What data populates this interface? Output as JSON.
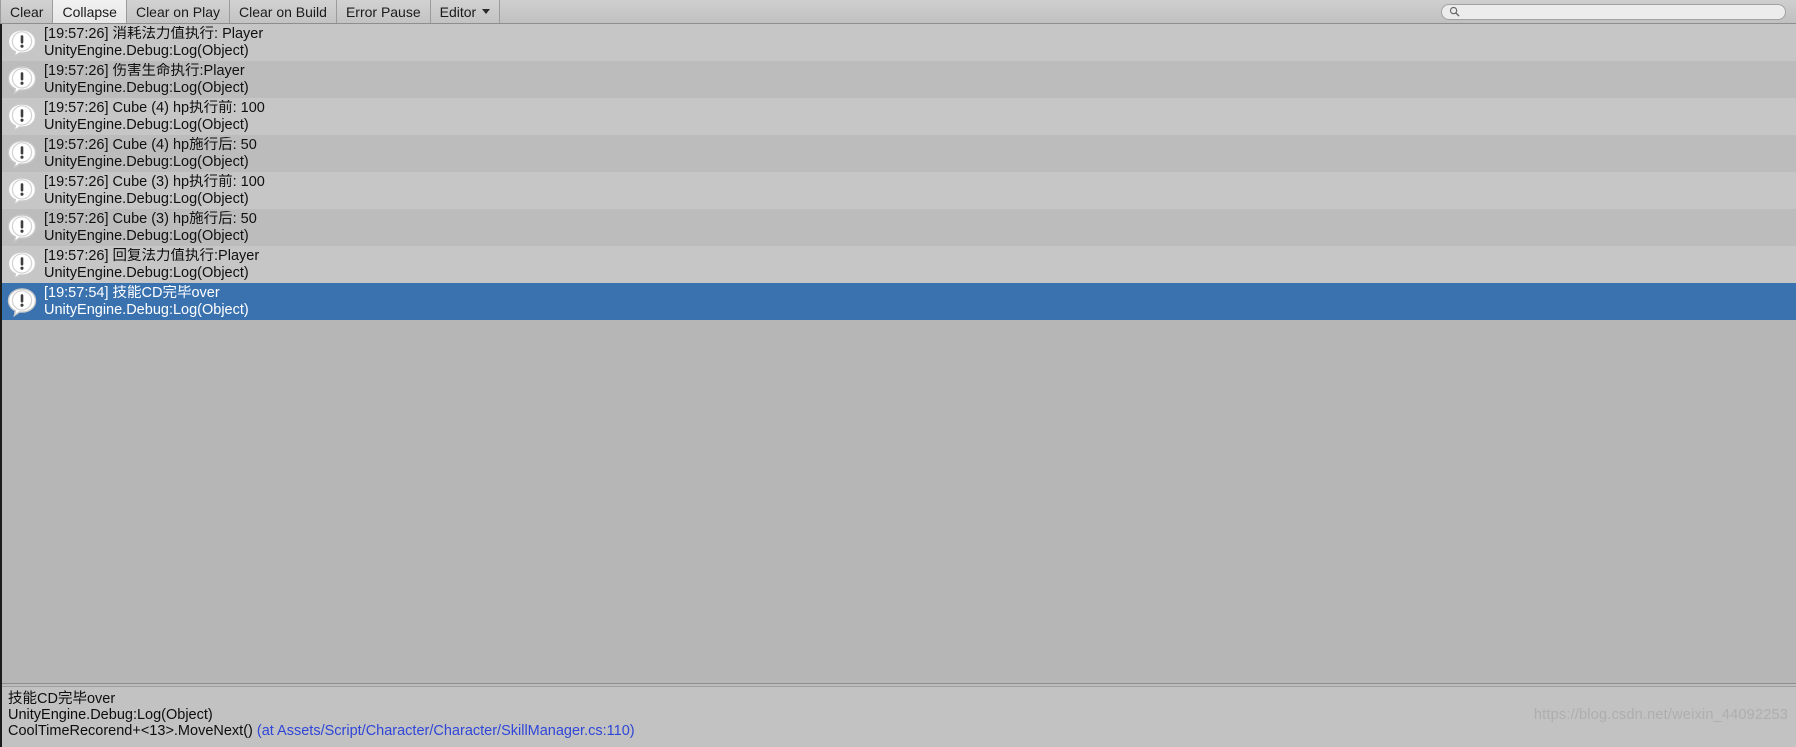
{
  "window": {
    "title": "Console",
    "accent_color": "#4a86c5",
    "selected_row_color": "#3a72b0",
    "row_color_even": "#c6c6c6",
    "row_color_odd": "#bcbcbc",
    "background_color": "#b6b6b6"
  },
  "toolbar": {
    "buttons": [
      {
        "label": "Clear",
        "toggled": false,
        "has_caret": false
      },
      {
        "label": "Collapse",
        "toggled": true,
        "has_caret": false
      },
      {
        "label": "Clear on Play",
        "toggled": false,
        "has_caret": false
      },
      {
        "label": "Clear on Build",
        "toggled": false,
        "has_caret": false
      },
      {
        "label": "Error Pause",
        "toggled": false,
        "has_caret": false
      },
      {
        "label": "Editor",
        "toggled": false,
        "has_caret": true
      }
    ],
    "search": {
      "value": "",
      "placeholder": "",
      "icon": "search-icon"
    }
  },
  "log_list": {
    "icon_name": "log-message-icon",
    "entries": [
      {
        "message": "[19:57:26] 消耗法力值执行:  Player",
        "stack": "UnityEngine.Debug:Log(Object)",
        "selected": false
      },
      {
        "message": "[19:57:26] 伤害生命执行:Player",
        "stack": "UnityEngine.Debug:Log(Object)",
        "selected": false
      },
      {
        "message": "[19:57:26] Cube (4) hp执行前: 100",
        "stack": "UnityEngine.Debug:Log(Object)",
        "selected": false
      },
      {
        "message": "[19:57:26] Cube (4) hp施行后: 50",
        "stack": "UnityEngine.Debug:Log(Object)",
        "selected": false
      },
      {
        "message": "[19:57:26] Cube (3) hp执行前: 100",
        "stack": "UnityEngine.Debug:Log(Object)",
        "selected": false
      },
      {
        "message": "[19:57:26] Cube (3) hp施行后: 50",
        "stack": "UnityEngine.Debug:Log(Object)",
        "selected": false
      },
      {
        "message": "[19:57:26] 回复法力值执行:Player",
        "stack": "UnityEngine.Debug:Log(Object)",
        "selected": false
      },
      {
        "message": "[19:57:54] 技能CD完毕over",
        "stack": "UnityEngine.Debug:Log(Object)",
        "selected": true
      }
    ]
  },
  "detail_pane": {
    "line1": "技能CD完毕over",
    "line2": "UnityEngine.Debug:Log(Object)",
    "line3_prefix": "CoolTimeRecorend+<13>.MoveNext() ",
    "line3_link": "(at Assets/Script/Character/Character/SkillManager.cs:110)"
  },
  "watermark": {
    "text": "https://blog.csdn.net/weixin_44092253"
  }
}
